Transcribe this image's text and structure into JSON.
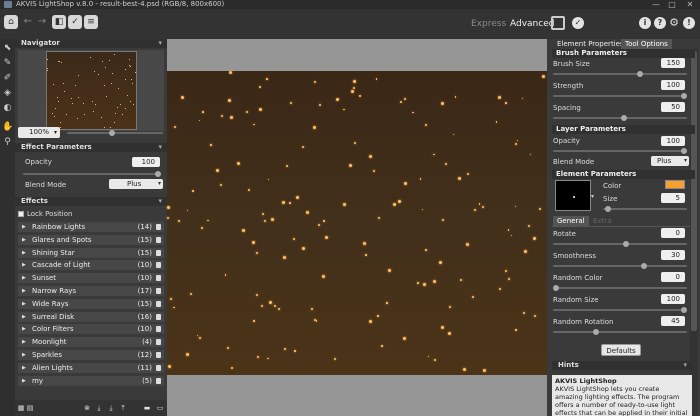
{
  "app": {
    "title": "AKVIS LightShop v.8.0 - result-best-4.psd (RGB/8, 800x600)"
  },
  "window": {
    "minimize": "—",
    "maximize": "□",
    "close": "✕"
  },
  "toolbar": {
    "express": "Express",
    "advanced": "Advanced"
  },
  "navigator": {
    "title": "Navigator",
    "zoom": "100%"
  },
  "effect_params": {
    "title": "Effect Parameters",
    "opacity_label": "Opacity",
    "opacity_value": "100",
    "opacity_level": 1.0,
    "blend_label": "Blend Mode",
    "blend_value": "Plus"
  },
  "effects": {
    "title": "Effects",
    "lock_label": "Lock Position",
    "items": [
      {
        "label": "Rainbow Lights",
        "count": "(14)"
      },
      {
        "label": "Glares and Spots",
        "count": "(15)"
      },
      {
        "label": "Shining Star",
        "count": "(15)"
      },
      {
        "label": "Cascade of Light",
        "count": "(10)"
      },
      {
        "label": "Sunset",
        "count": "(10)"
      },
      {
        "label": "Narrow Rays",
        "count": "(17)"
      },
      {
        "label": "Wide Rays",
        "count": "(15)"
      },
      {
        "label": "Surreal Disk",
        "count": "(16)"
      },
      {
        "label": "Color Filters",
        "count": "(10)"
      },
      {
        "label": "Moonlight",
        "count": "(4)"
      },
      {
        "label": "Sparkles",
        "count": "(12)"
      },
      {
        "label": "Alien Lights",
        "count": "(11)"
      },
      {
        "label": "my",
        "count": "(5)"
      }
    ]
  },
  "right": {
    "tab_element": "Element Properties",
    "tab_tool": "Tool Options",
    "brush": {
      "title": "Brush Parameters",
      "size_label": "Brush Size",
      "size_value": "150",
      "strength_label": "Strength",
      "strength_value": "100",
      "spacing_label": "Spacing",
      "spacing_value": "50"
    },
    "layer": {
      "title": "Layer Parameters",
      "opacity_label": "Opacity",
      "opacity_value": "100",
      "blend_label": "Blend Mode",
      "blend_value": "Plus"
    },
    "element": {
      "title": "Element Parameters",
      "color_label": "Color",
      "color": "#f5a030",
      "size_label": "Size",
      "size_value": "5"
    },
    "general_tab": "General",
    "extra_tab": "Extra",
    "rotate_label": "Rotate",
    "rotate_value": "0",
    "smooth_label": "Smoothness",
    "smooth_value": "30",
    "rcolor_label": "Random Color",
    "rcolor_value": "0",
    "rsize_label": "Random Size",
    "rsize_value": "100",
    "rrot_label": "Random Rotation",
    "rrot_value": "45",
    "defaults": "Defaults",
    "hints_title": "Hints",
    "hints_heading": "AKVIS LightShop",
    "hints_text": "AKVIS LightShop lets you create amazing lighting effects. The program offers a number of ready-to-use light effects that can be applied in their initial version or can be modified. A bit"
  },
  "colors": {
    "accent": "#f5a030",
    "background": "#3c3c3c"
  }
}
